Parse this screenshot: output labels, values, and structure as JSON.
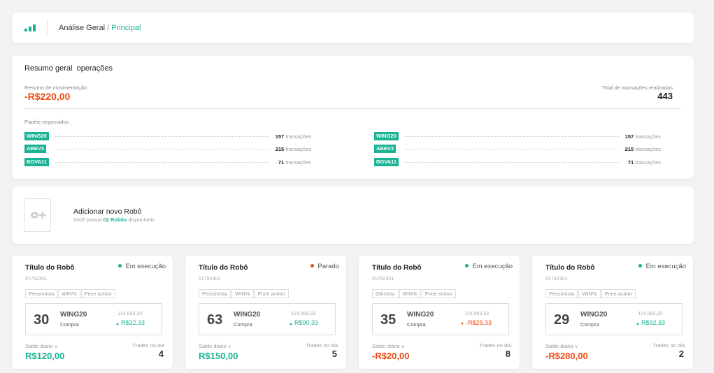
{
  "colors": {
    "accent": "#1ab394",
    "negative": "#ef4b12",
    "stopped": "#ef4b12"
  },
  "header": {
    "icon": "bar-chart-icon",
    "section": "Análise Geral",
    "separator": "/",
    "current": "Principal"
  },
  "summary": {
    "title": "Resumo geral  operações",
    "movement_label": "Resumo de movimentação",
    "movement_value": "-R$220,00",
    "total_label": "Total de transações realizadas",
    "total_value": "443",
    "papers_label": "Papéis negociados",
    "papers_left": [
      {
        "ticker": "WING20",
        "count": "157",
        "unit": "transações"
      },
      {
        "ticker": "ABEV3",
        "count": "215",
        "unit": "transações"
      },
      {
        "ticker": "BOVA11",
        "count": "71",
        "unit": "transações"
      }
    ],
    "papers_right": [
      {
        "ticker": "WING20",
        "count": "157",
        "unit": "transações"
      },
      {
        "ticker": "ABEV3",
        "count": "215",
        "unit": "transações"
      },
      {
        "ticker": "BOVA11",
        "count": "71",
        "unit": "transações"
      }
    ]
  },
  "add_robot": {
    "icon": "robot-add-icon",
    "title": "Adicionar novo Robô",
    "subtitle_pre": "Você possui ",
    "subtitle_highlight": "02 Robôs",
    "subtitle_post": " disponíveis"
  },
  "robots": [
    {
      "title": "Título do Robô",
      "id": "#1792301",
      "status": "Em execução",
      "status_color": "#1ab394",
      "chips": [
        "Pessimista",
        "WIN%",
        "Price action"
      ],
      "trades": "30",
      "ticker": "WING20",
      "operation": "Compra",
      "price": "114.093,33",
      "change": "R$32,33",
      "direction": "up",
      "change_color": "#1ab394",
      "daily_label": "Saldo diário",
      "daily_value": "R$120,00",
      "daily_color": "#1ab394",
      "trades_label": "Trades no dia",
      "trades_day": "4"
    },
    {
      "title": "Título do Robô",
      "id": "#1792301",
      "status": "Parado",
      "status_color": "#ef4b12",
      "chips": [
        "Pessimista",
        "WIN%",
        "Price action"
      ],
      "trades": "63",
      "ticker": "WING20",
      "operation": "Compra",
      "price": "114.093,33",
      "change": "R$90,33",
      "direction": "up",
      "change_color": "#1ab394",
      "daily_label": "Saldo diário",
      "daily_value": "R$150,00",
      "daily_color": "#1ab394",
      "trades_label": "Trades no dia",
      "trades_day": "5"
    },
    {
      "title": "Título do Robô",
      "id": "#1792301",
      "status": "Em execução",
      "status_color": "#1ab394",
      "chips": [
        "Otimista",
        "WIN%",
        "Price action"
      ],
      "trades": "35",
      "ticker": "WING20",
      "operation": "Compra",
      "price": "114.093,33",
      "change": "-R$25,33",
      "direction": "down",
      "change_color": "#ef4b12",
      "daily_label": "Saldo diário",
      "daily_value": "-R$20,00",
      "daily_color": "#ef4b12",
      "trades_label": "Trades no dia",
      "trades_day": "8"
    },
    {
      "title": "Título do Robô",
      "id": "#1792301",
      "status": "Em execução",
      "status_color": "#1ab394",
      "chips": [
        "Pessimista",
        "WIN%",
        "Price action"
      ],
      "trades": "29",
      "ticker": "WING20",
      "operation": "Compra",
      "price": "114.093,33",
      "change": "R$92,33",
      "direction": "up",
      "change_color": "#1ab394",
      "daily_label": "Saldo diário",
      "daily_value": "-R$280,00",
      "daily_color": "#ef4b12",
      "trades_label": "Trades no dia",
      "trades_day": "2"
    }
  ]
}
